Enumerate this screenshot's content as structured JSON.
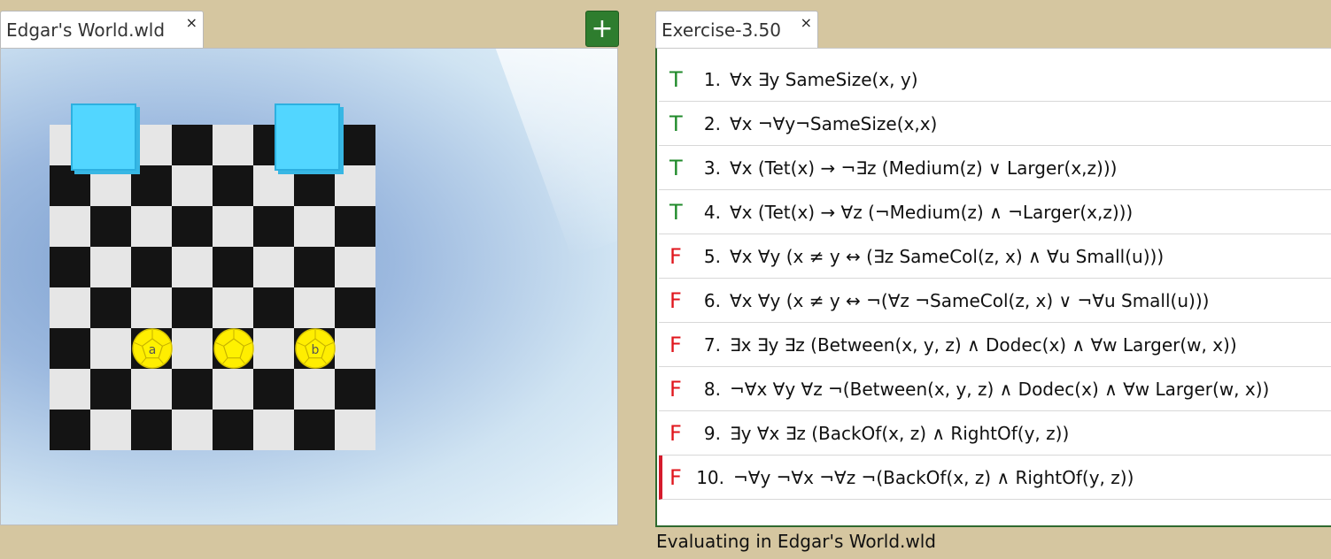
{
  "tabs": {
    "world": {
      "label": "Edgar's World.wld",
      "close": "×"
    },
    "exercise": {
      "label": "Exercise-3.50",
      "close": "×"
    },
    "add_label": "+"
  },
  "world": {
    "board_size": 8,
    "pieces": [
      {
        "shape": "cube",
        "color": "cyan",
        "col": 0,
        "row": 0
      },
      {
        "shape": "cube",
        "color": "cyan",
        "col": 5,
        "row": 0
      },
      {
        "shape": "dodec",
        "color": "yellow",
        "col": 2,
        "row": 5,
        "label": "a"
      },
      {
        "shape": "dodec",
        "color": "yellow",
        "col": 4,
        "row": 5,
        "label": ""
      },
      {
        "shape": "dodec",
        "color": "yellow",
        "col": 6,
        "row": 5,
        "label": "b"
      }
    ]
  },
  "sentences": [
    {
      "truth": "T",
      "num": "1.",
      "text": "∀x ∃y SameSize(x, y)"
    },
    {
      "truth": "T",
      "num": "2.",
      "text": "∀x ¬∀y¬SameSize(x,x)"
    },
    {
      "truth": "T",
      "num": "3.",
      "text": "∀x (Tet(x) → ¬∃z (Medium(z) ∨ Larger(x,z)))"
    },
    {
      "truth": "T",
      "num": "4.",
      "text": "∀x (Tet(x) → ∀z (¬Medium(z) ∧ ¬Larger(x,z)))"
    },
    {
      "truth": "F",
      "num": "5.",
      "text": "∀x ∀y (x ≠ y ↔ (∃z SameCol(z, x) ∧ ∀u Small(u)))"
    },
    {
      "truth": "F",
      "num": "6.",
      "text": "∀x ∀y (x ≠ y ↔ ¬(∀z ¬SameCol(z, x) ∨ ¬∀u Small(u)))"
    },
    {
      "truth": "F",
      "num": "7.",
      "text": "∃x ∃y ∃z (Between(x, y, z) ∧ Dodec(x) ∧ ∀w Larger(w,  x))"
    },
    {
      "truth": "F",
      "num": "8.",
      "text": "¬∀x ∀y ∀z ¬(Between(x, y, z) ∧ Dodec(x) ∧ ∀w Larger(w,  x))"
    },
    {
      "truth": "F",
      "num": "9.",
      "text": "∃y ∀x ∃z (BackOf(x, z) ∧ RightOf(y, z))"
    },
    {
      "truth": "F",
      "num": "10.",
      "text": "¬∀y ¬∀x ¬∀z ¬(BackOf(x, z) ∧ RightOf(y, z))",
      "selected": true
    }
  ],
  "status": "Evaluating in Edgar's World.wld",
  "colors": {
    "background": "#d5c6a0",
    "true": "#1f8a2a",
    "false": "#e0161d",
    "selection": "#d51b2c",
    "cube": "#52d6ff",
    "dodec": "#ffee00"
  }
}
